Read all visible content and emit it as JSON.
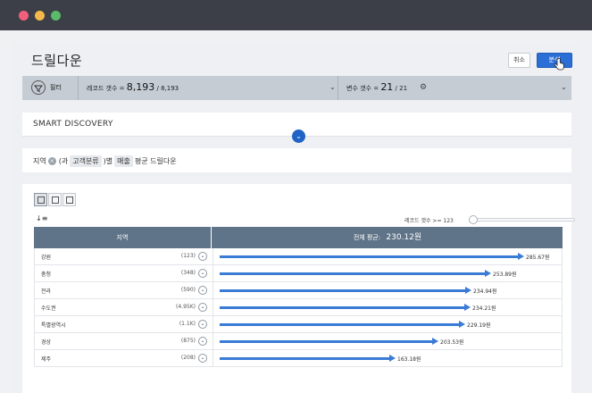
{
  "header": {
    "title": "드릴다운",
    "cancel_label": "취소",
    "analyze_label": "분석"
  },
  "filterbar": {
    "filter_label": "필터",
    "record_label": "레코드 갯수 =",
    "record_value": "8,193",
    "record_total": "/ 8,193",
    "var_label": "변수 갯수 =",
    "var_value": "21",
    "var_total": "/ 21"
  },
  "smart": {
    "title": "SMART DISCOVERY"
  },
  "breadcrumb": {
    "dim": "지역",
    "p1": "(과",
    "group": "고객분류",
    "p2": ")별",
    "measure": "매출",
    "suffix": "평균 드릴다운"
  },
  "panel": {
    "threshold_label": "레코드 갯수 >= 123",
    "threshold_fraction": 0.0
  },
  "table": {
    "col_region": "지역",
    "col_avg_label": "전체 평균:",
    "col_avg_value": "230.12원",
    "max_value": 285.67,
    "rows": [
      {
        "name": "강원",
        "count": "(123)",
        "value": 285.67,
        "label": "285.67원"
      },
      {
        "name": "충청",
        "count": "(348)",
        "value": 253.89,
        "label": "253.89원"
      },
      {
        "name": "전라",
        "count": "(590)",
        "value": 234.94,
        "label": "234.94원"
      },
      {
        "name": "수도권",
        "count": "(4.95K)",
        "value": 234.21,
        "label": "234.21원"
      },
      {
        "name": "특별광역시",
        "count": "(1.1K)",
        "value": 229.19,
        "label": "229.19원"
      },
      {
        "name": "경상",
        "count": "(875)",
        "value": 203.53,
        "label": "203.53원"
      },
      {
        "name": "제주",
        "count": "(208)",
        "value": 163.18,
        "label": "163.18원"
      }
    ]
  }
}
